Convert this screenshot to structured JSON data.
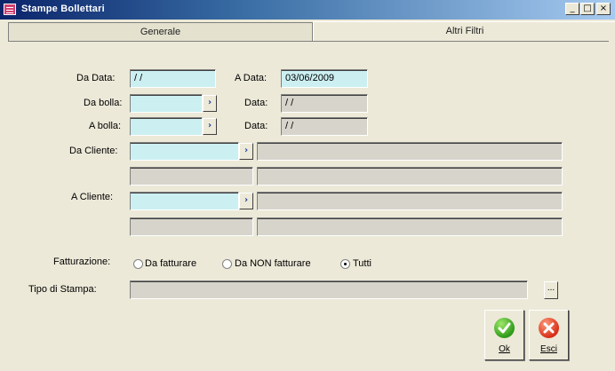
{
  "window": {
    "title": "Stampe Bollettari",
    "minimize": "_",
    "maximize": "□",
    "close": "×"
  },
  "tabs": [
    {
      "label": "Generale"
    },
    {
      "label": "Altri Filtri"
    }
  ],
  "form": {
    "da_data_label": "Da Data:",
    "da_data_value": "/ /",
    "a_data_label": "A Data:",
    "a_data_value": "03/06/2009",
    "da_bolla_label": "Da bolla:",
    "da_bolla_value": "",
    "da_bolla_data_label": "Data:",
    "da_bolla_data_value": "/ /",
    "a_bolla_label": "A bolla:",
    "a_bolla_value": "",
    "a_bolla_data_label": "Data:",
    "a_bolla_data_value": "/ /",
    "da_cliente_label": "Da Cliente:",
    "a_cliente_label": "A Cliente:",
    "lookup_glyph": "›",
    "fatturazione_label": "Fatturazione:",
    "fatturazione_options": [
      {
        "label": "Da fatturare",
        "selected": false
      },
      {
        "label": "Da NON fatturare",
        "selected": false
      },
      {
        "label": "Tutti",
        "selected": true
      }
    ],
    "tipo_stampa_label": "Tipo di Stampa:",
    "tipo_stampa_value": "",
    "browse_label": "..."
  },
  "buttons": {
    "ok_label": "Ok",
    "esci_label": "Esci"
  },
  "colors": {
    "title_bar": "#0a246a",
    "lookup_field": "#ccf0f2",
    "window_bg": "#ece9d8",
    "ok_icon": "#2f9a1a",
    "esci_icon": "#d8301a"
  }
}
